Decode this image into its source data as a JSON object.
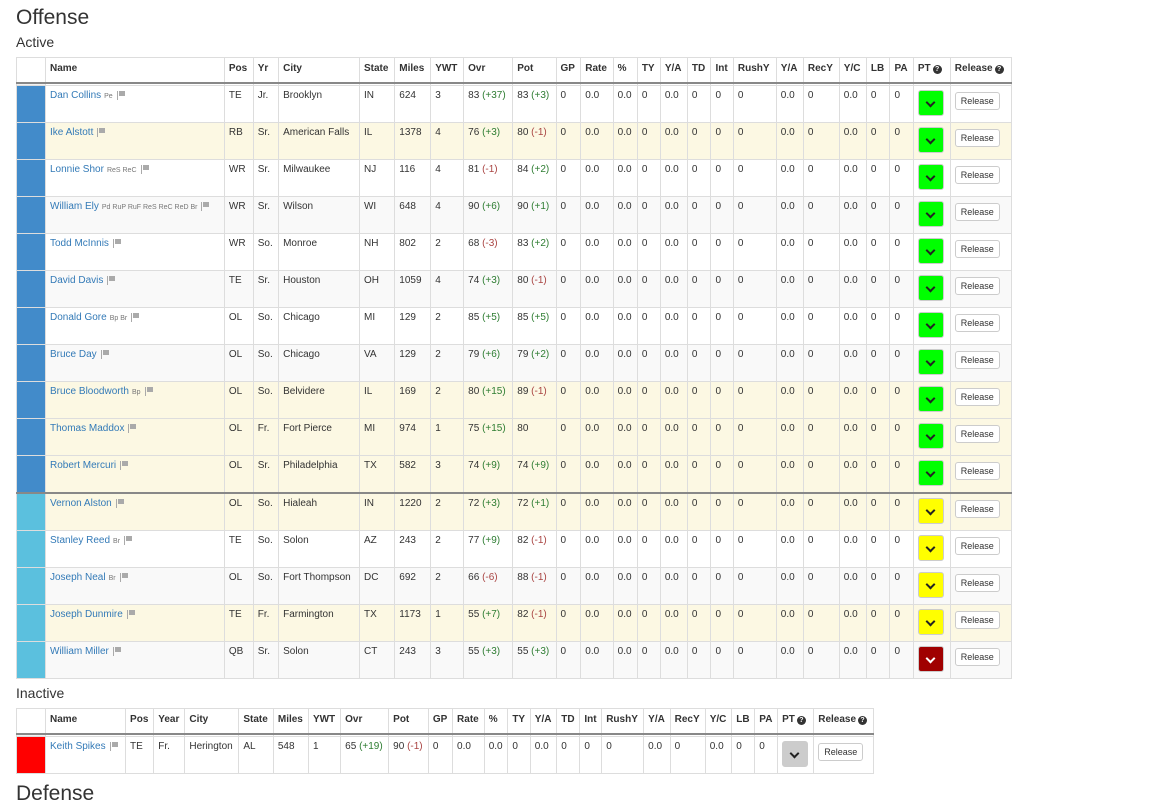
{
  "section_title": "Offense",
  "next_section_title": "Defense",
  "colors": {
    "starter_bar": "#428bca",
    "backup_bar": "#5bc0de",
    "inactive_bar": "#ff0000",
    "pt_green": "#00ff00",
    "pt_yellow": "#ffff00",
    "pt_red": "#a00000",
    "pt_gray": "#cccccc",
    "positive_delta": "#2e7d32",
    "negative_delta": "#a94442"
  },
  "active": {
    "label": "Active",
    "headers": [
      "",
      "Name",
      "Pos",
      "Yr",
      "City",
      "State",
      "Miles",
      "YWT",
      "Ovr",
      "Pot",
      "GP",
      "Rate",
      "%",
      "TY",
      "Y/A",
      "TD",
      "Int",
      "RushY",
      "Y/A",
      "RecY",
      "Y/C",
      "LB",
      "PA",
      "PT",
      "Release"
    ],
    "help_icon": "question-circle-icon",
    "rows": [
      {
        "bar": "starter",
        "bg": "default",
        "name": "Dan Collins",
        "tags": "Pe",
        "pos": "TE",
        "yr": "Jr.",
        "city": "Brooklyn",
        "state": "IN",
        "miles": "624",
        "ywt": "3",
        "ovr": "83",
        "ovr_delta": "(+37)",
        "pot": "83",
        "pot_delta": "(+3)",
        "stats": [
          "0",
          "0.0",
          "0.0",
          "0",
          "0.0",
          "0",
          "0",
          "0",
          "0.0",
          "0",
          "0.0",
          "0",
          "0"
        ],
        "pt": "green",
        "release": "Release"
      },
      {
        "bar": "starter",
        "bg": "warning",
        "name": "Ike Alstott",
        "tags": "",
        "pos": "RB",
        "yr": "Sr.",
        "city": "American Falls",
        "state": "IL",
        "miles": "1378",
        "ywt": "4",
        "ovr": "76",
        "ovr_delta": "(+3)",
        "pot": "80",
        "pot_delta": "(-1)",
        "stats": [
          "0",
          "0.0",
          "0.0",
          "0",
          "0.0",
          "0",
          "0",
          "0",
          "0.0",
          "0",
          "0.0",
          "0",
          "0"
        ],
        "pt": "green",
        "release": "Release"
      },
      {
        "bar": "starter",
        "bg": "default",
        "name": "Lonnie Shor",
        "tags": "ReS ReC",
        "pos": "WR",
        "yr": "Sr.",
        "city": "Milwaukee",
        "state": "NJ",
        "miles": "116",
        "ywt": "4",
        "ovr": "81",
        "ovr_delta": "(-1)",
        "pot": "84",
        "pot_delta": "(+2)",
        "stats": [
          "0",
          "0.0",
          "0.0",
          "0",
          "0.0",
          "0",
          "0",
          "0",
          "0.0",
          "0",
          "0.0",
          "0",
          "0"
        ],
        "pt": "green",
        "release": "Release"
      },
      {
        "bar": "starter",
        "bg": "striped",
        "name": "William Ely",
        "tags": "Pd RuP RuF ReS ReC ReD Br",
        "pos": "WR",
        "yr": "Sr.",
        "city": "Wilson",
        "state": "WI",
        "miles": "648",
        "ywt": "4",
        "ovr": "90",
        "ovr_delta": "(+6)",
        "pot": "90",
        "pot_delta": "(+1)",
        "stats": [
          "0",
          "0.0",
          "0.0",
          "0",
          "0.0",
          "0",
          "0",
          "0",
          "0.0",
          "0",
          "0.0",
          "0",
          "0"
        ],
        "pt": "green",
        "release": "Release"
      },
      {
        "bar": "starter",
        "bg": "default",
        "name": "Todd McInnis",
        "tags": "",
        "pos": "WR",
        "yr": "So.",
        "city": "Monroe",
        "state": "NH",
        "miles": "802",
        "ywt": "2",
        "ovr": "68",
        "ovr_delta": "(-3)",
        "pot": "83",
        "pot_delta": "(+2)",
        "stats": [
          "0",
          "0.0",
          "0.0",
          "0",
          "0.0",
          "0",
          "0",
          "0",
          "0.0",
          "0",
          "0.0",
          "0",
          "0"
        ],
        "pt": "green",
        "release": "Release"
      },
      {
        "bar": "starter",
        "bg": "striped",
        "name": "David Davis",
        "tags": "",
        "pos": "TE",
        "yr": "Sr.",
        "city": "Houston",
        "state": "OH",
        "miles": "1059",
        "ywt": "4",
        "ovr": "74",
        "ovr_delta": "(+3)",
        "pot": "80",
        "pot_delta": "(-1)",
        "stats": [
          "0",
          "0.0",
          "0.0",
          "0",
          "0.0",
          "0",
          "0",
          "0",
          "0.0",
          "0",
          "0.0",
          "0",
          "0"
        ],
        "pt": "green",
        "release": "Release"
      },
      {
        "bar": "starter",
        "bg": "default",
        "name": "Donald Gore",
        "tags": "Bp Br",
        "pos": "OL",
        "yr": "So.",
        "city": "Chicago",
        "state": "MI",
        "miles": "129",
        "ywt": "2",
        "ovr": "85",
        "ovr_delta": "(+5)",
        "pot": "85",
        "pot_delta": "(+5)",
        "stats": [
          "0",
          "0.0",
          "0.0",
          "0",
          "0.0",
          "0",
          "0",
          "0",
          "0.0",
          "0",
          "0.0",
          "0",
          "0"
        ],
        "pt": "green",
        "release": "Release"
      },
      {
        "bar": "starter",
        "bg": "striped",
        "name": "Bruce Day",
        "tags": "",
        "pos": "OL",
        "yr": "So.",
        "city": "Chicago",
        "state": "VA",
        "miles": "129",
        "ywt": "2",
        "ovr": "79",
        "ovr_delta": "(+6)",
        "pot": "79",
        "pot_delta": "(+2)",
        "stats": [
          "0",
          "0.0",
          "0.0",
          "0",
          "0.0",
          "0",
          "0",
          "0",
          "0.0",
          "0",
          "0.0",
          "0",
          "0"
        ],
        "pt": "green",
        "release": "Release"
      },
      {
        "bar": "starter",
        "bg": "warning",
        "name": "Bruce Bloodworth",
        "tags": "Bp",
        "pos": "OL",
        "yr": "So.",
        "city": "Belvidere",
        "state": "IL",
        "miles": "169",
        "ywt": "2",
        "ovr": "80",
        "ovr_delta": "(+15)",
        "pot": "89",
        "pot_delta": "(-1)",
        "stats": [
          "0",
          "0.0",
          "0.0",
          "0",
          "0.0",
          "0",
          "0",
          "0",
          "0.0",
          "0",
          "0.0",
          "0",
          "0"
        ],
        "pt": "green",
        "release": "Release"
      },
      {
        "bar": "starter",
        "bg": "warning",
        "name": "Thomas Maddox",
        "tags": "",
        "pos": "OL",
        "yr": "Fr.",
        "city": "Fort Pierce",
        "state": "MI",
        "miles": "974",
        "ywt": "1",
        "ovr": "75",
        "ovr_delta": "(+15)",
        "pot": "80",
        "pot_delta": "",
        "stats": [
          "0",
          "0.0",
          "0.0",
          "0",
          "0.0",
          "0",
          "0",
          "0",
          "0.0",
          "0",
          "0.0",
          "0",
          "0"
        ],
        "pt": "green",
        "release": "Release"
      },
      {
        "bar": "starter",
        "bg": "warning",
        "name": "Robert Mercuri",
        "tags": "",
        "pos": "OL",
        "yr": "Sr.",
        "city": "Philadelphia",
        "state": "TX",
        "miles": "582",
        "ywt": "3",
        "ovr": "74",
        "ovr_delta": "(+9)",
        "pot": "74",
        "pot_delta": "(+9)",
        "stats": [
          "0",
          "0.0",
          "0.0",
          "0",
          "0.0",
          "0",
          "0",
          "0",
          "0.0",
          "0",
          "0.0",
          "0",
          "0"
        ],
        "pt": "green",
        "release": "Release"
      },
      {
        "bar": "backup",
        "bg": "warning",
        "sep": true,
        "name": "Vernon Alston",
        "tags": "",
        "pos": "OL",
        "yr": "So.",
        "city": "Hialeah",
        "state": "IN",
        "miles": "1220",
        "ywt": "2",
        "ovr": "72",
        "ovr_delta": "(+3)",
        "pot": "72",
        "pot_delta": "(+1)",
        "stats": [
          "0",
          "0.0",
          "0.0",
          "0",
          "0.0",
          "0",
          "0",
          "0",
          "0.0",
          "0",
          "0.0",
          "0",
          "0"
        ],
        "pt": "yellow",
        "release": "Release"
      },
      {
        "bar": "backup",
        "bg": "default",
        "name": "Stanley Reed",
        "tags": "Br",
        "pos": "TE",
        "yr": "So.",
        "city": "Solon",
        "state": "AZ",
        "miles": "243",
        "ywt": "2",
        "ovr": "77",
        "ovr_delta": "(+9)",
        "pot": "82",
        "pot_delta": "(-1)",
        "stats": [
          "0",
          "0.0",
          "0.0",
          "0",
          "0.0",
          "0",
          "0",
          "0",
          "0.0",
          "0",
          "0.0",
          "0",
          "0"
        ],
        "pt": "yellow",
        "release": "Release"
      },
      {
        "bar": "backup",
        "bg": "striped",
        "name": "Joseph Neal",
        "tags": "Br",
        "pos": "OL",
        "yr": "So.",
        "city": "Fort Thompson",
        "state": "DC",
        "miles": "692",
        "ywt": "2",
        "ovr": "66",
        "ovr_delta": "(-6)",
        "pot": "88",
        "pot_delta": "(-1)",
        "stats": [
          "0",
          "0.0",
          "0.0",
          "0",
          "0.0",
          "0",
          "0",
          "0",
          "0.0",
          "0",
          "0.0",
          "0",
          "0"
        ],
        "pt": "yellow",
        "release": "Release"
      },
      {
        "bar": "backup",
        "bg": "warning",
        "name": "Joseph Dunmire",
        "tags": "",
        "pos": "TE",
        "yr": "Fr.",
        "city": "Farmington",
        "state": "TX",
        "miles": "1173",
        "ywt": "1",
        "ovr": "55",
        "ovr_delta": "(+7)",
        "pot": "82",
        "pot_delta": "(-1)",
        "stats": [
          "0",
          "0.0",
          "0.0",
          "0",
          "0.0",
          "0",
          "0",
          "0",
          "0.0",
          "0",
          "0.0",
          "0",
          "0"
        ],
        "pt": "yellow",
        "release": "Release"
      },
      {
        "bar": "backup",
        "bg": "striped",
        "name": "William Miller",
        "tags": "",
        "pos": "QB",
        "yr": "Sr.",
        "city": "Solon",
        "state": "CT",
        "miles": "243",
        "ywt": "3",
        "ovr": "55",
        "ovr_delta": "(+3)",
        "pot": "55",
        "pot_delta": "(+3)",
        "stats": [
          "0",
          "0.0",
          "0.0",
          "0",
          "0.0",
          "0",
          "0",
          "0",
          "0.0",
          "0",
          "0.0",
          "0",
          "0"
        ],
        "pt": "red",
        "release": "Release"
      }
    ]
  },
  "inactive": {
    "label": "Inactive",
    "headers": [
      "",
      "Name",
      "Pos",
      "Year",
      "City",
      "State",
      "Miles",
      "YWT",
      "Ovr",
      "Pot",
      "GP",
      "Rate",
      "%",
      "TY",
      "Y/A",
      "TD",
      "Int",
      "RushY",
      "Y/A",
      "RecY",
      "Y/C",
      "LB",
      "PA",
      "PT",
      "Release"
    ],
    "rows": [
      {
        "bar": "inactive",
        "bg": "default",
        "name": "Keith Spikes",
        "tags": "",
        "pos": "TE",
        "yr": "Fr.",
        "city": "Herington",
        "state": "AL",
        "miles": "548",
        "ywt": "1",
        "ovr": "65",
        "ovr_delta": "(+19)",
        "pot": "90",
        "pot_delta": "(-1)",
        "stats": [
          "0",
          "0.0",
          "0.0",
          "0",
          "0.0",
          "0",
          "0",
          "0",
          "0.0",
          "0",
          "0.0",
          "0",
          "0"
        ],
        "pt": "gray",
        "release": "Release"
      }
    ]
  }
}
